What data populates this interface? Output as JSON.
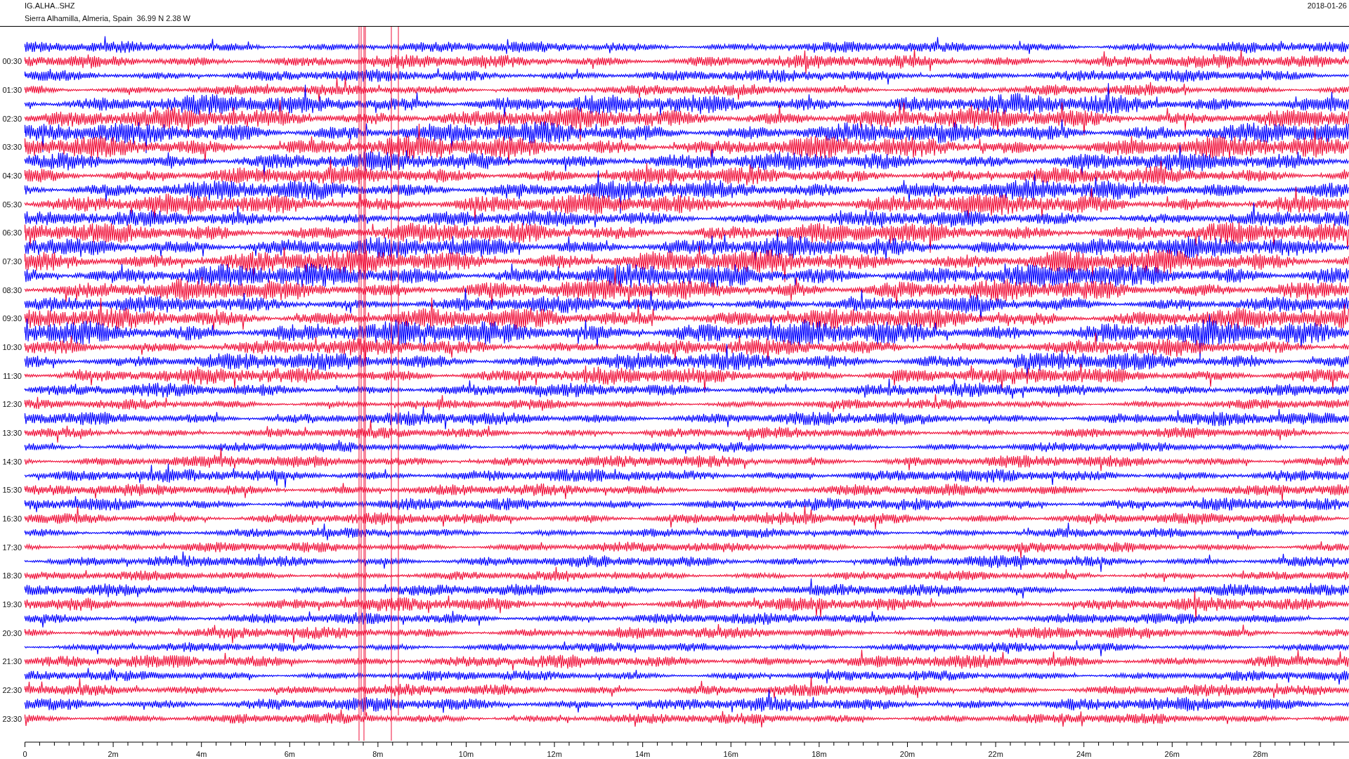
{
  "header": {
    "station": "IG.ALHA..SHZ",
    "location": "Sierra Alhamilla, Almeria, Spain  36.99 N 2.38 W",
    "date": "2018-01-26"
  },
  "helicorder": {
    "row_labels": [
      "00:30",
      "01:30",
      "02:30",
      "03:30",
      "04:30",
      "05:30",
      "06:30",
      "07:30",
      "08:30",
      "09:30",
      "10:30",
      "11:30",
      "12:30",
      "13:30",
      "14:30",
      "15:30",
      "16:30",
      "17:30",
      "18:30",
      "19:30",
      "20:30",
      "21:30",
      "22:30",
      "23:30"
    ],
    "x_axis_labels": [
      "0",
      "2m",
      "4m",
      "6m",
      "8m",
      "10m",
      "12m",
      "14m",
      "16m",
      "18m",
      "20m",
      "22m",
      "24m",
      "26m",
      "28m"
    ]
  }
}
